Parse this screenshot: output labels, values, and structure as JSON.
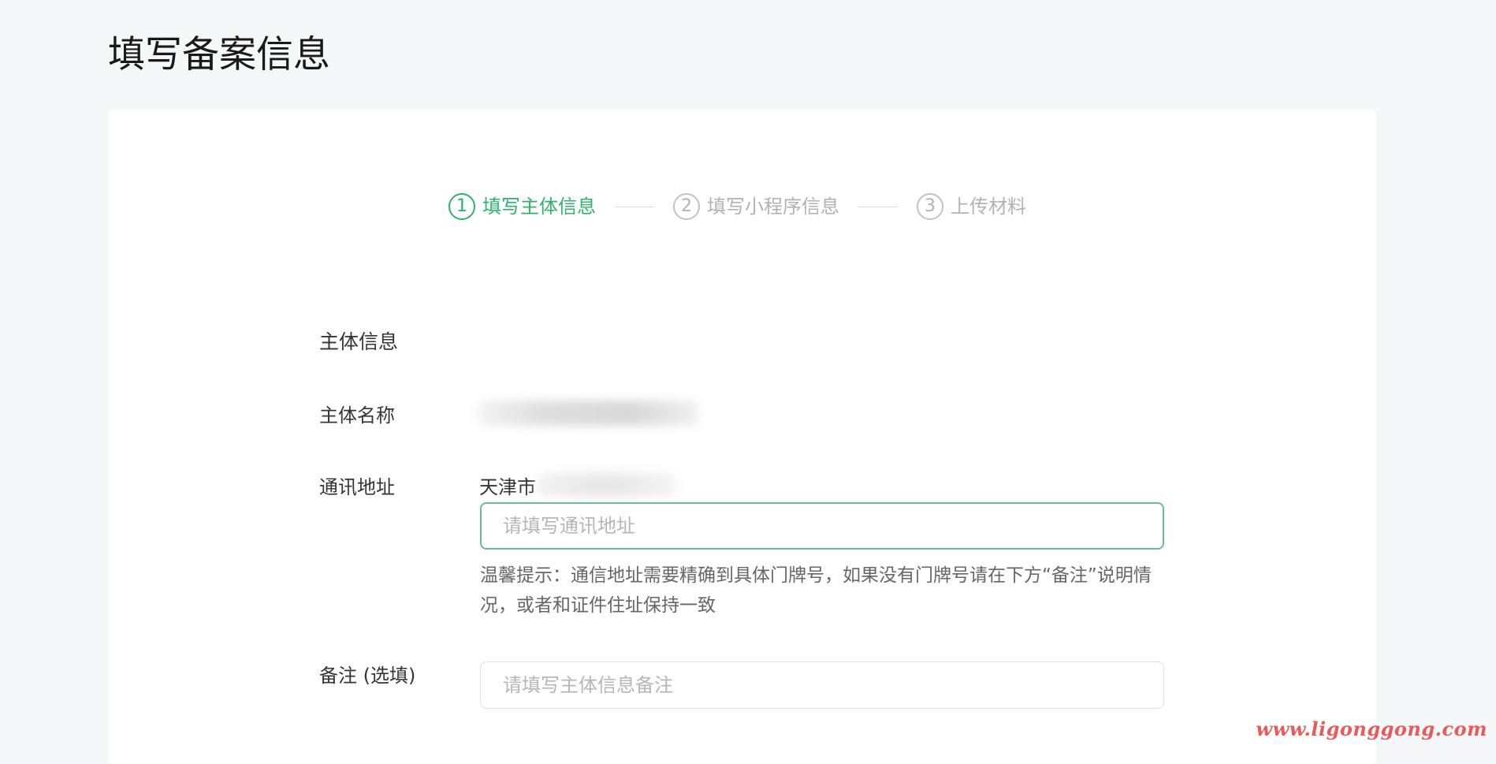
{
  "page": {
    "title": "填写备案信息"
  },
  "steps": [
    {
      "number": "1",
      "label": "填写主体信息",
      "active": true
    },
    {
      "number": "2",
      "label": "填写小程序信息",
      "active": false
    },
    {
      "number": "3",
      "label": "上传材料",
      "active": false
    }
  ],
  "form": {
    "section_title": "主体信息",
    "entity_name": {
      "label": "主体名称"
    },
    "address": {
      "label": "通讯地址",
      "region_prefix": "天津市",
      "placeholder": "请填写通讯地址",
      "hint": "温馨提示：通信地址需要精确到具体门牌号，如果没有门牌号请在下方“备注”说明情况，或者和证件住址保持一致"
    },
    "remark": {
      "label": "备注 (选填)",
      "placeholder": "请填写主体信息备注"
    }
  },
  "watermark": "www.ligonggong.com",
  "colors": {
    "accent_green": "#2fb36a",
    "focus_border": "#67c08d",
    "inactive_step": "#b2b2b2",
    "watermark_red": "#e85b5b"
  }
}
